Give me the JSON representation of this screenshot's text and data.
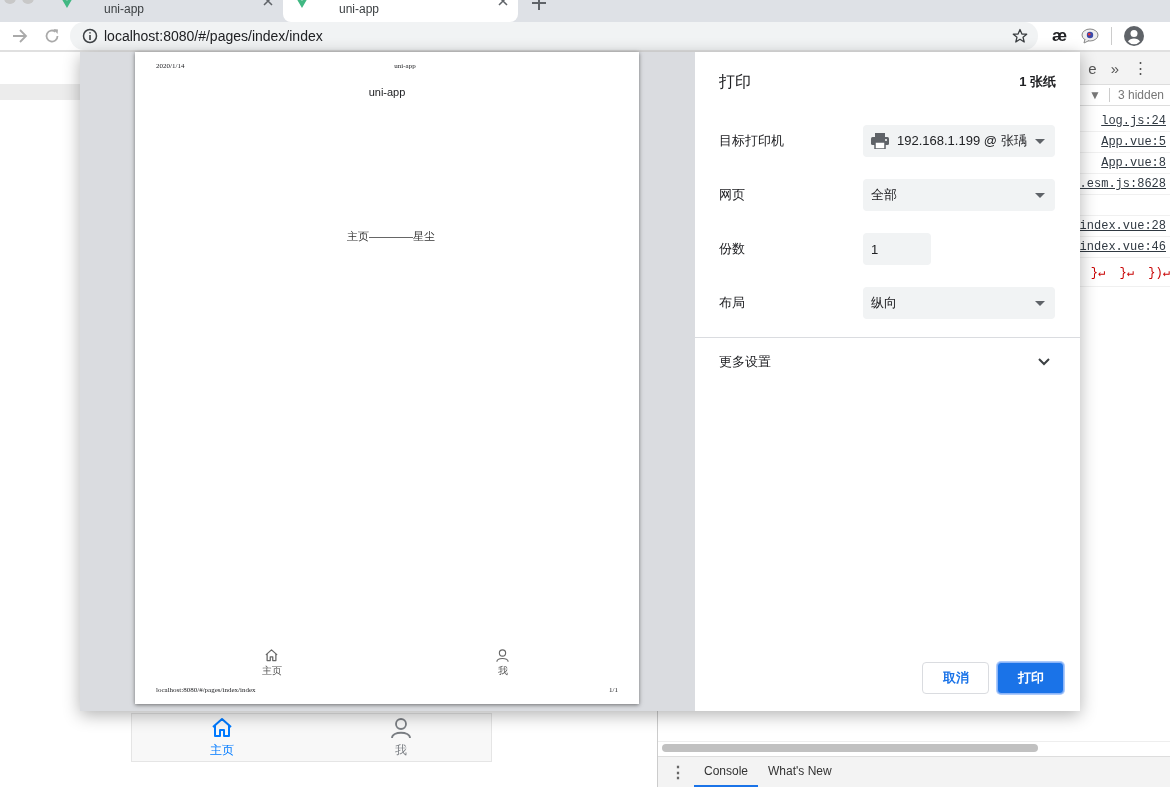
{
  "browser": {
    "tabs": [
      {
        "title": "uni-app",
        "selected": false
      },
      {
        "title": "uni-app",
        "selected": true
      }
    ],
    "address": "localhost:8080/#/pages/index/index",
    "extension_text": "æ"
  },
  "page": {
    "tab_bar": [
      {
        "label": "主页",
        "kind": "home",
        "selected": true
      },
      {
        "label": "我",
        "kind": "person",
        "selected": false
      }
    ]
  },
  "devtools": {
    "toolbar": [
      "e",
      "»",
      "⋮"
    ],
    "filter_arrow": "▼",
    "hidden_count": "3 hidden",
    "log_links": [
      "log.js:24",
      "App.vue:5",
      "App.vue:8",
      ".esm.js:8628"
    ],
    "later_log_links": [
      "index.vue:28",
      "index.vue:46"
    ],
    "code_line": "}↵  }↵  })↵",
    "drawer_menu": "⋮",
    "drawer_tabs": [
      {
        "label": "Console",
        "selected": true
      },
      {
        "label": "What's New",
        "selected": false
      }
    ]
  },
  "print_dialog": {
    "title": "打印",
    "sheets": "1 张纸",
    "preview": {
      "date": "2020/1/14",
      "header_title": "uni-app",
      "page_title": "uni-app",
      "body": "主页————星尘",
      "tab_bar": [
        {
          "label": "主页",
          "kind": "home"
        },
        {
          "label": "我",
          "kind": "person"
        }
      ],
      "url": "localhost:8080/#/pages/index/index",
      "page_number": "1/1"
    },
    "settings": [
      {
        "label": "目标打印机",
        "kind": "printer",
        "value": "192.168.1.199 @ 张瑀"
      },
      {
        "label": "网页",
        "kind": "select",
        "value": "全部"
      },
      {
        "label": "份数",
        "kind": "input",
        "value": "1"
      },
      {
        "label": "布局",
        "kind": "select",
        "value": "纵向"
      }
    ],
    "more_settings": "更多设置",
    "buttons": [
      {
        "label": "取消",
        "kind": "secondary"
      },
      {
        "label": "打印",
        "kind": "primary"
      }
    ]
  }
}
